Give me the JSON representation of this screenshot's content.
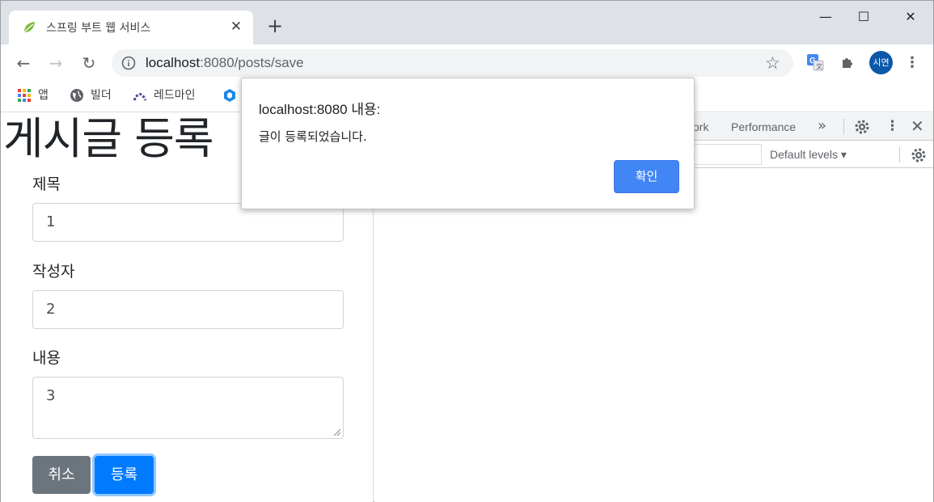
{
  "browser": {
    "tab_title": "스프링 부트 웹 서비스",
    "tab_close": "✕",
    "new_tab": "+",
    "window_controls": {
      "minimize": "—",
      "maximize": "☐",
      "close": "✕"
    },
    "url_host": "localhost",
    "url_path": ":8080/posts/save",
    "profile_initials": "시연",
    "bookmarks": [
      {
        "label": "앱",
        "icon": "apps-grid-icon"
      },
      {
        "label": "빌더",
        "icon": "globe-icon"
      },
      {
        "label": "레드마인",
        "icon": "redmine-icon"
      }
    ]
  },
  "page": {
    "title": "게시글 등록",
    "fields": {
      "title_label": "제목",
      "title_value": "1",
      "author_label": "작성자",
      "author_value": "2",
      "content_label": "내용",
      "content_value": "3"
    },
    "buttons": {
      "cancel": "취소",
      "save": "등록"
    }
  },
  "devtools": {
    "tab_network_partial": "ork",
    "tab_performance": "Performance",
    "more_tabs": "»",
    "levels": "Default levels ▾"
  },
  "dialog": {
    "title": "localhost:8080 내용:",
    "message": "글이 등록되었습니다.",
    "ok": "확인"
  },
  "colors": {
    "primary": "#007bff",
    "secondary": "#6c757d",
    "dialog_button": "#4285f4",
    "profile": "#0b57a8"
  }
}
